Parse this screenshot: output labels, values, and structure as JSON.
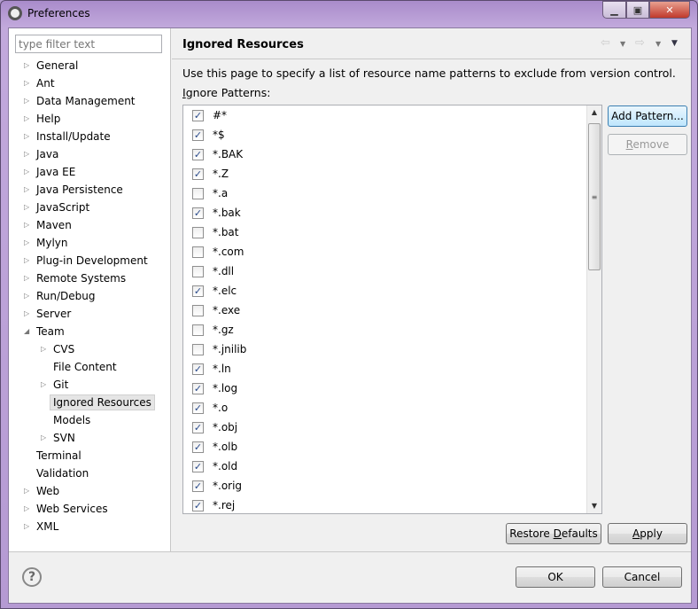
{
  "window": {
    "title": "Preferences",
    "controls": [
      "minimize",
      "maximize",
      "close"
    ]
  },
  "filter": {
    "placeholder": "type filter text"
  },
  "tree": [
    {
      "label": "General",
      "level": 0,
      "expandable": true
    },
    {
      "label": "Ant",
      "level": 0,
      "expandable": true
    },
    {
      "label": "Data Management",
      "level": 0,
      "expandable": true
    },
    {
      "label": "Help",
      "level": 0,
      "expandable": true
    },
    {
      "label": "Install/Update",
      "level": 0,
      "expandable": true
    },
    {
      "label": "Java",
      "level": 0,
      "expandable": true
    },
    {
      "label": "Java EE",
      "level": 0,
      "expandable": true
    },
    {
      "label": "Java Persistence",
      "level": 0,
      "expandable": true
    },
    {
      "label": "JavaScript",
      "level": 0,
      "expandable": true
    },
    {
      "label": "Maven",
      "level": 0,
      "expandable": true
    },
    {
      "label": "Mylyn",
      "level": 0,
      "expandable": true
    },
    {
      "label": "Plug-in Development",
      "level": 0,
      "expandable": true
    },
    {
      "label": "Remote Systems",
      "level": 0,
      "expandable": true
    },
    {
      "label": "Run/Debug",
      "level": 0,
      "expandable": true
    },
    {
      "label": "Server",
      "level": 0,
      "expandable": true
    },
    {
      "label": "Team",
      "level": 0,
      "expandable": true,
      "expanded": true
    },
    {
      "label": "CVS",
      "level": 1,
      "expandable": true
    },
    {
      "label": "File Content",
      "level": 1,
      "expandable": false
    },
    {
      "label": "Git",
      "level": 1,
      "expandable": true
    },
    {
      "label": "Ignored Resources",
      "level": 1,
      "expandable": false,
      "selected": true
    },
    {
      "label": "Models",
      "level": 1,
      "expandable": false
    },
    {
      "label": "SVN",
      "level": 1,
      "expandable": true
    },
    {
      "label": "Terminal",
      "level": 0,
      "expandable": false
    },
    {
      "label": "Validation",
      "level": 0,
      "expandable": false
    },
    {
      "label": "Web",
      "level": 0,
      "expandable": true
    },
    {
      "label": "Web Services",
      "level": 0,
      "expandable": true
    },
    {
      "label": "XML",
      "level": 0,
      "expandable": true
    }
  ],
  "page": {
    "title": "Ignored Resources",
    "description": "Use this page to specify a list of resource name patterns to exclude from version control.",
    "patterns_label_mnemonic": "I",
    "patterns_label_rest": "gnore Patterns:",
    "patterns": [
      {
        "name": "#*",
        "checked": true
      },
      {
        "name": "*$",
        "checked": true
      },
      {
        "name": "*.BAK",
        "checked": true
      },
      {
        "name": "*.Z",
        "checked": true
      },
      {
        "name": "*.a",
        "checked": false
      },
      {
        "name": "*.bak",
        "checked": true
      },
      {
        "name": "*.bat",
        "checked": false
      },
      {
        "name": "*.com",
        "checked": false
      },
      {
        "name": "*.dll",
        "checked": false
      },
      {
        "name": "*.elc",
        "checked": true
      },
      {
        "name": "*.exe",
        "checked": false
      },
      {
        "name": "*.gz",
        "checked": false
      },
      {
        "name": "*.jnilib",
        "checked": false
      },
      {
        "name": "*.ln",
        "checked": true
      },
      {
        "name": "*.log",
        "checked": true
      },
      {
        "name": "*.o",
        "checked": true
      },
      {
        "name": "*.obj",
        "checked": true
      },
      {
        "name": "*.olb",
        "checked": true
      },
      {
        "name": "*.old",
        "checked": true
      },
      {
        "name": "*.orig",
        "checked": true
      },
      {
        "name": "*.rej",
        "checked": true
      }
    ],
    "add_pattern": "Add Pattern...",
    "remove_mnemonic": "R",
    "remove_rest": "emove",
    "restore_pre": "Restore ",
    "restore_mnemonic": "D",
    "restore_rest": "efaults",
    "apply_mnemonic": "A",
    "apply_rest": "pply"
  },
  "footer": {
    "ok": "OK",
    "cancel": "Cancel",
    "help_icon": "?"
  }
}
